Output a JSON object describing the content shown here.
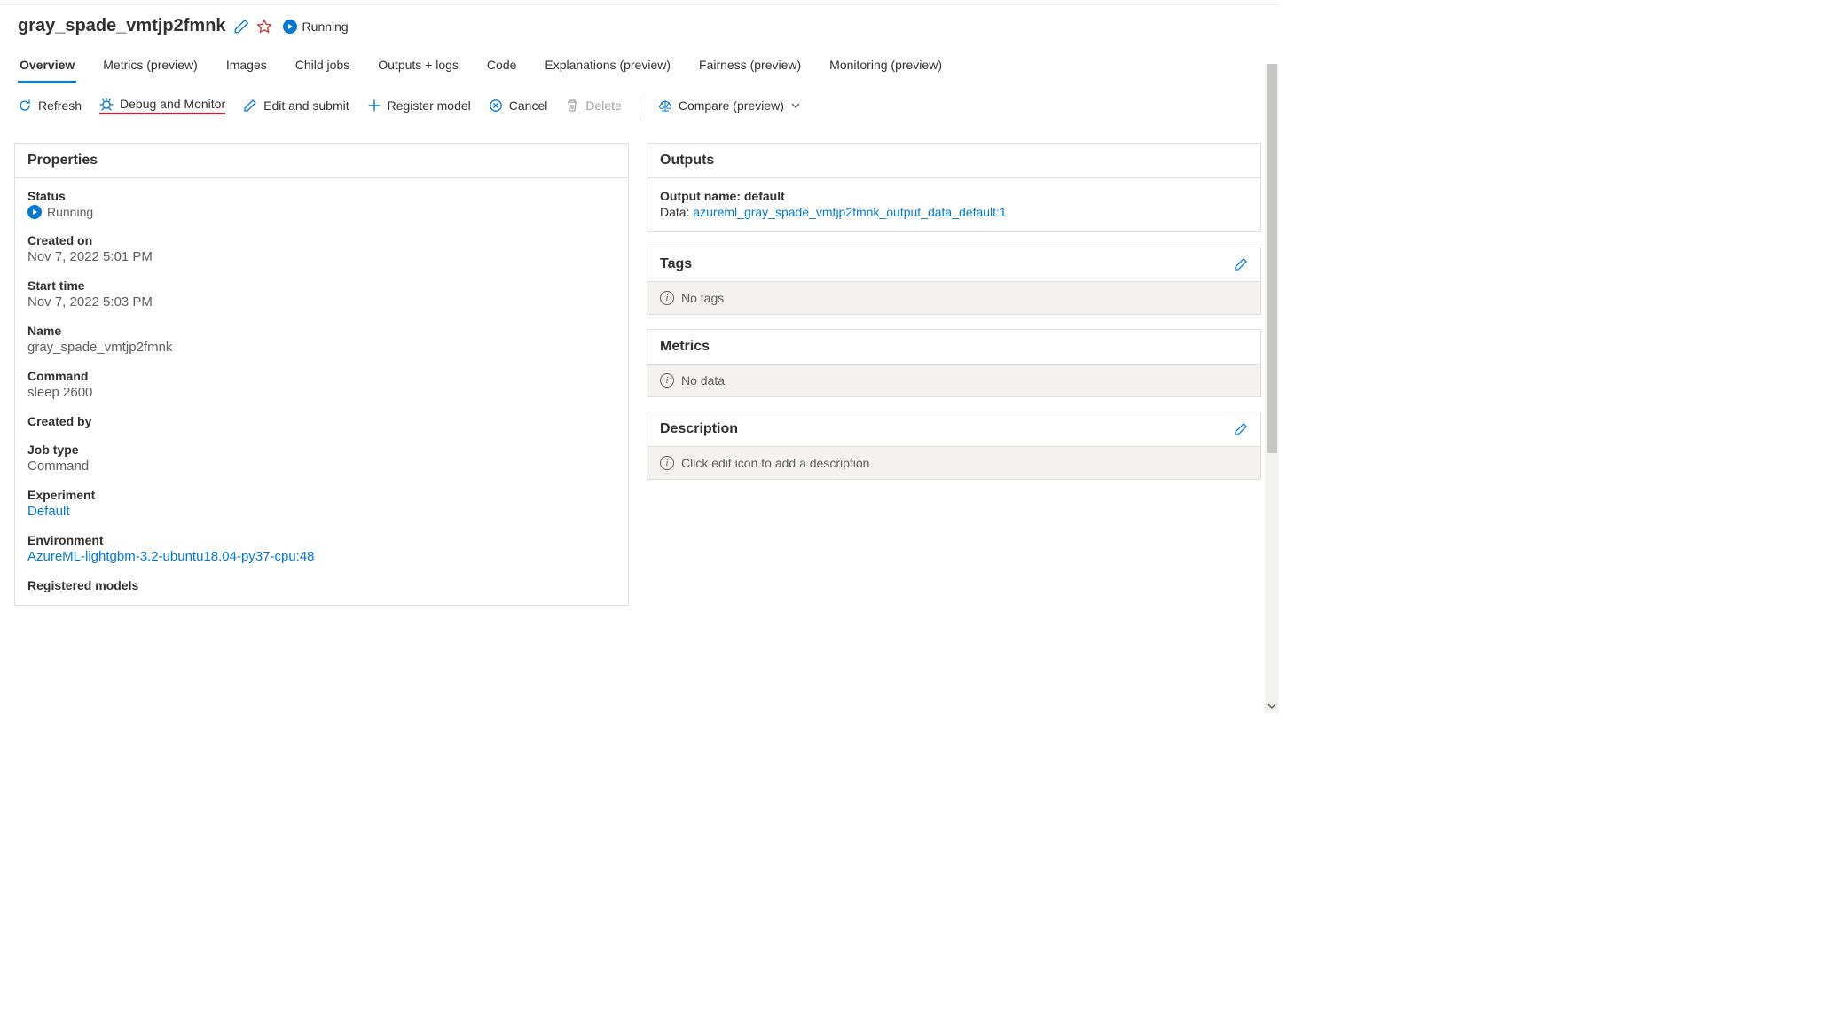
{
  "header": {
    "title": "gray_spade_vmtjp2fmnk",
    "status_label": "Running"
  },
  "tabs": [
    {
      "label": "Overview",
      "active": true
    },
    {
      "label": "Metrics (preview)",
      "active": false
    },
    {
      "label": "Images",
      "active": false
    },
    {
      "label": "Child jobs",
      "active": false
    },
    {
      "label": "Outputs + logs",
      "active": false
    },
    {
      "label": "Code",
      "active": false
    },
    {
      "label": "Explanations (preview)",
      "active": false
    },
    {
      "label": "Fairness (preview)",
      "active": false
    },
    {
      "label": "Monitoring (preview)",
      "active": false
    }
  ],
  "toolbar": {
    "refresh": "Refresh",
    "debug_monitor": "Debug and Monitor",
    "edit_submit": "Edit and submit",
    "register_model": "Register model",
    "cancel": "Cancel",
    "delete": "Delete",
    "compare": "Compare (preview)"
  },
  "properties": {
    "title": "Properties",
    "status": {
      "label": "Status",
      "value": "Running"
    },
    "created_on": {
      "label": "Created on",
      "value": "Nov 7, 2022 5:01 PM"
    },
    "start_time": {
      "label": "Start time",
      "value": "Nov 7, 2022 5:03 PM"
    },
    "name": {
      "label": "Name",
      "value": "gray_spade_vmtjp2fmnk"
    },
    "command": {
      "label": "Command",
      "value": "sleep 2600"
    },
    "created_by": {
      "label": "Created by",
      "value": ""
    },
    "job_type": {
      "label": "Job type",
      "value": "Command"
    },
    "experiment": {
      "label": "Experiment",
      "value": "Default"
    },
    "environment": {
      "label": "Environment",
      "value": "AzureML-lightgbm-3.2-ubuntu18.04-py37-cpu:48"
    },
    "registered_models": {
      "label": "Registered models"
    }
  },
  "outputs": {
    "title": "Outputs",
    "name_label": "Output name: default",
    "data_prefix": "Data: ",
    "data_link": "azureml_gray_spade_vmtjp2fmnk_output_data_default:1"
  },
  "tags": {
    "title": "Tags",
    "empty": "No tags"
  },
  "metrics": {
    "title": "Metrics",
    "empty": "No data"
  },
  "description": {
    "title": "Description",
    "empty": "Click edit icon to add a description"
  }
}
